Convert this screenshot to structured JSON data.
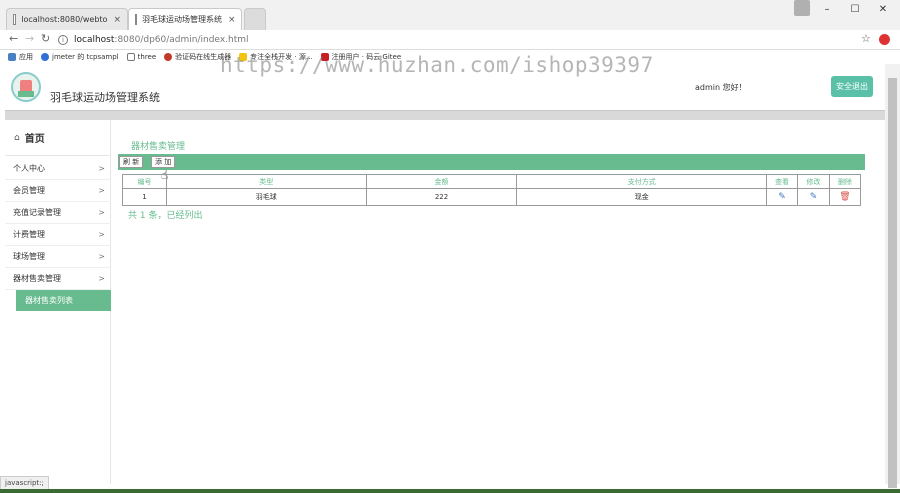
{
  "browser": {
    "tabs": [
      {
        "label": "localhost:8080/webto",
        "close": "×"
      },
      {
        "label": "羽毛球运动场管理系统",
        "close": "×"
      }
    ],
    "url_host": "localhost",
    "url_path": ":8080/dp60/admin/index.html",
    "bookmarks": [
      "应用",
      "jmeter 的 tcpsampl",
      "three",
      "验证码在线生成器",
      "专注全栈开发 · 源...",
      "注册用户 · 码云 Gitee"
    ],
    "status_text": "javascript:;",
    "watermark": "https://www.huzhan.com/ishop39397"
  },
  "header": {
    "site_title": "羽毛球运动场管理系统",
    "greeting": "admin 您好！",
    "logout_label": "安全退出"
  },
  "sidebar": {
    "home_label": "首页",
    "items": [
      {
        "label": "个人中心",
        "arrow": ">"
      },
      {
        "label": "会员管理",
        "arrow": ">"
      },
      {
        "label": "充值记录管理",
        "arrow": ">"
      },
      {
        "label": "计费管理",
        "arrow": ">"
      },
      {
        "label": "球场管理",
        "arrow": ">"
      },
      {
        "label": "器材售卖管理",
        "arrow": ">"
      }
    ],
    "active_sub": "器材售卖列表"
  },
  "main": {
    "title": "器材售卖管理",
    "toolbar": {
      "refresh_label": "刷 新",
      "add_label": "添 加"
    },
    "columns": [
      "编号",
      "类型",
      "金额",
      "支付方式",
      "查看",
      "修改",
      "删除"
    ],
    "rows": [
      {
        "id": "1",
        "type": "羽毛球",
        "amount": "222",
        "pay": "现金"
      }
    ],
    "count_text": "共 1 条，已经列出"
  },
  "colors": {
    "accent": "#67bb8f",
    "logout": "#5bc0a8"
  }
}
